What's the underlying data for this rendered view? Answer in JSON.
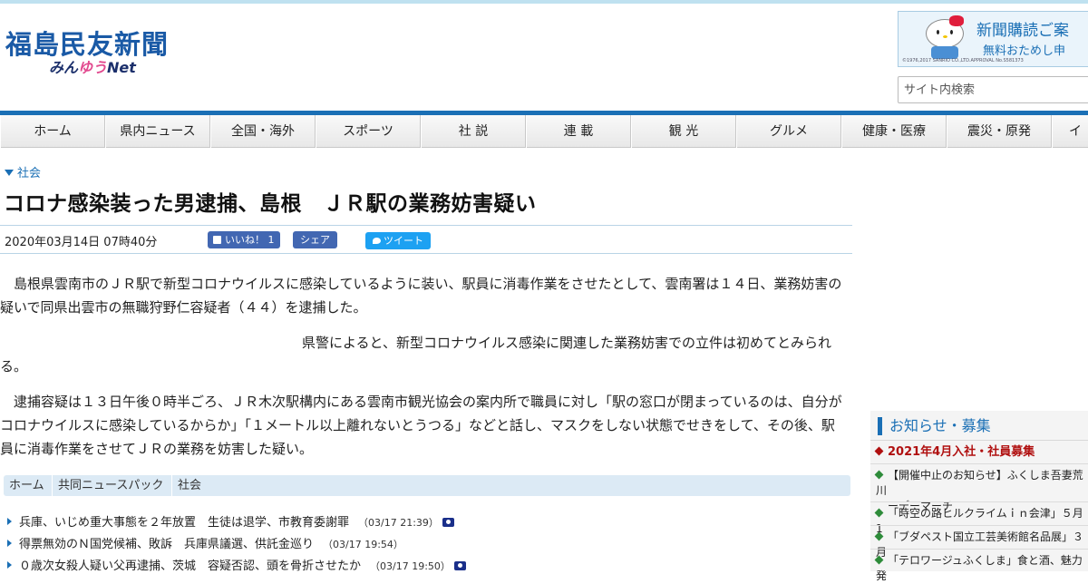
{
  "site": {
    "logo_main": "福島民友新聞",
    "logo_sub_prefix": "みん",
    "logo_sub_accent": "ゆう",
    "logo_sub_suffix": "Net"
  },
  "banner": {
    "line1": "新聞購読ご案",
    "line2": "無料おためし申",
    "copyright": "©1976,2017 SANRIO CO.,LTD.APPROVAL No.S581373"
  },
  "search": {
    "placeholder": "サイト内検索"
  },
  "nav": {
    "items": [
      "ホーム",
      "県内ニュース",
      "全国・海外",
      "スポーツ",
      "社 説",
      "連 載",
      "観 光",
      "グルメ",
      "健康・医療",
      "震災・原発",
      "イ"
    ]
  },
  "article": {
    "category": "社会",
    "headline": "コロナ感染装った男逮捕、島根　ＪＲ駅の業務妨害疑い",
    "date": "2020年03月14日 07時40分",
    "paragraphs": [
      "島根県雲南市のＪＲ駅で新型コロナウイルスに感染しているように装い、駅員に消毒作業をさせたとして、雲南署は１４日、業務妨害の疑いで同県出雲市の無職狩野仁容疑者（４４）を逮捕した。",
      "県警によると、新型コロナウイルス感染に関連した業務妨害での立件は初めてとみられる。",
      "逮捕容疑は１３日午後０時半ごろ、ＪＲ木次駅構内にある雲南市観光協会の案内所で職員に対し「駅の窓口が閉まっているのは、自分がコロナウイルスに感染しているからか」「１メートル以上離れないとうつる」などと話し、マスクをしない状態でせきをして、その後、駅員に消毒作業をさせてＪＲの業務を妨害した疑い。"
    ]
  },
  "social": {
    "like_label": "いいね！ 1",
    "share_label": "シェア",
    "tweet_label": "ツイート"
  },
  "breadcrumb": [
    "ホーム",
    "共同ニュースパック",
    "社会"
  ],
  "related": [
    {
      "title": "兵庫、いじめ重大事態を２年放置　生徒は退学、市教育委謝罪",
      "date": "（03/17 21:39）",
      "photo": true
    },
    {
      "title": "得票無効のＮ国党候補、敗訴　兵庫県議選、供託金巡り",
      "date": "（03/17 19:54）",
      "photo": false
    },
    {
      "title": "０歳次女殺人疑い父再逮捕、茨城　容疑否認、頭を骨折させたか",
      "date": "（03/17 19:50）",
      "photo": true
    }
  ],
  "sidebar": {
    "title": "お知らせ・募集",
    "items": [
      {
        "text": "2021年4月入社・社員募集",
        "hot": true
      },
      {
        "text": "【開催中止のお知らせ】ふくしま吾妻荒川",
        "cont": "ーデーマーチ"
      },
      {
        "text": "「時空の路ヒルクライムｉｎ会津」５月1"
      },
      {
        "text": "「ブダペスト国立工芸美術館名品展」３月"
      },
      {
        "text": "「テロワージュふくしま」食と酒、魅力発"
      }
    ]
  },
  "colors": {
    "accent": "#1a6fb5",
    "facebook": "#4267b2",
    "twitter": "#1da1f2",
    "alert": "#b01010"
  }
}
